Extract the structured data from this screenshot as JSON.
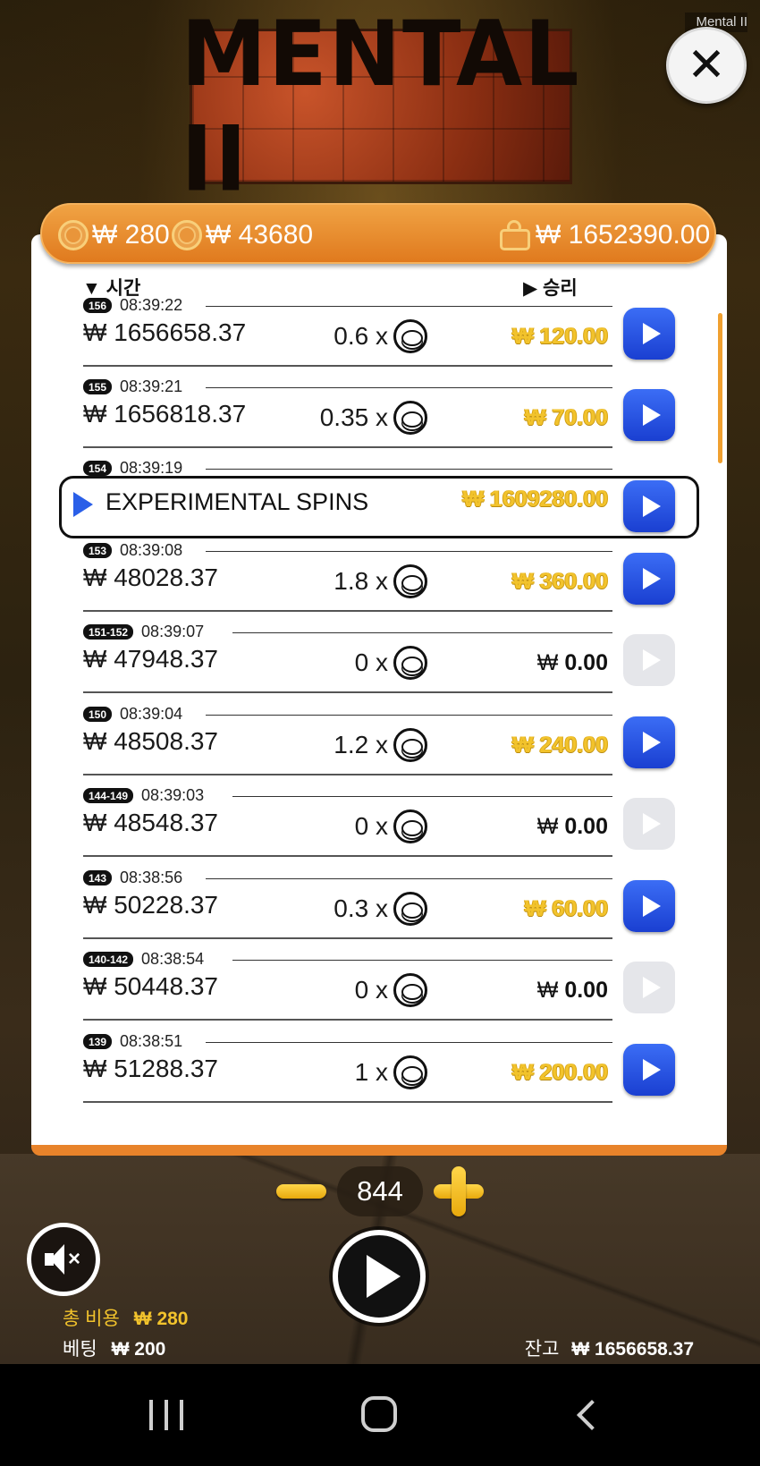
{
  "window": {
    "title": "Mental II"
  },
  "logo": {
    "text": "MENTAL II"
  },
  "topbar": {
    "bet_cost": "₩ 280",
    "coin_value": "₩ 43680",
    "wallet_balance": "₩ 1652390.00"
  },
  "history": {
    "col_time": "시간",
    "col_win": "승리",
    "rows": [
      {
        "round": "156",
        "time": "08:39:22",
        "balance": "₩ 1656658.37",
        "multiplier": "0.6 x",
        "win": "₩ 120.00",
        "win_type": "gold",
        "replay": "enabled"
      },
      {
        "round": "155",
        "time": "08:39:21",
        "balance": "₩ 1656818.37",
        "multiplier": "0.35 x",
        "win": "₩ 70.00",
        "win_type": "gold",
        "replay": "enabled"
      },
      {
        "round": "154",
        "time": "08:39:19",
        "label": "EXPERIMENTAL SPINS",
        "win": "₩ 1609280.00",
        "win_type": "gold",
        "replay": "enabled"
      },
      {
        "round": "153",
        "time": "08:39:08",
        "balance": "₩ 48028.37",
        "multiplier": "1.8 x",
        "win": "₩ 360.00",
        "win_type": "gold",
        "replay": "enabled"
      },
      {
        "round": "151-152",
        "time": "08:39:07",
        "balance": "₩ 47948.37",
        "multiplier": "0 x",
        "win_currency": "₩",
        "win_amount": "0.00",
        "win_type": "zero",
        "replay": "disabled"
      },
      {
        "round": "150",
        "time": "08:39:04",
        "balance": "₩ 48508.37",
        "multiplier": "1.2 x",
        "win": "₩ 240.00",
        "win_type": "gold",
        "replay": "enabled"
      },
      {
        "round": "144-149",
        "time": "08:39:03",
        "balance": "₩ 48548.37",
        "multiplier": "0 x",
        "win_currency": "₩",
        "win_amount": "0.00",
        "win_type": "zero",
        "replay": "disabled"
      },
      {
        "round": "143",
        "time": "08:38:56",
        "balance": "₩ 50228.37",
        "multiplier": "0.3 x",
        "win": "₩ 60.00",
        "win_type": "gold",
        "replay": "enabled"
      },
      {
        "round": "140-142",
        "time": "08:38:54",
        "balance": "₩ 50448.37",
        "multiplier": "0 x",
        "win_currency": "₩",
        "win_amount": "0.00",
        "win_type": "zero",
        "replay": "disabled"
      },
      {
        "round": "139",
        "time": "08:38:51",
        "balance": "₩ 51288.37",
        "multiplier": "1 x",
        "win": "₩ 200.00",
        "win_type": "gold",
        "replay": "enabled"
      }
    ]
  },
  "controls": {
    "spin_count": "844",
    "total_cost_label": "총 비용",
    "total_cost_value": "₩ 280",
    "bet_label": "베팅",
    "bet_value": "₩ 200",
    "balance_label": "잔고",
    "balance_value": "₩ 1656658.37"
  },
  "colors": {
    "accent_orange": "#e8832a",
    "replay_blue": "#2a5fe8",
    "win_gold": "#f2c32c"
  },
  "icons": {
    "close": "close-icon",
    "coin": "coin-icon",
    "wallet": "wallet-icon",
    "replay": "play-icon",
    "mute": "speaker-mute-icon",
    "spin": "play-icon"
  }
}
